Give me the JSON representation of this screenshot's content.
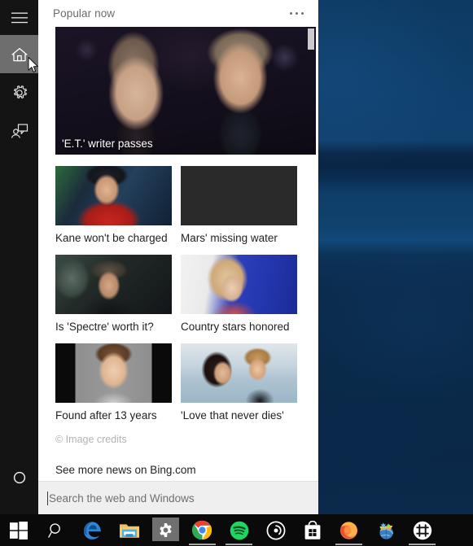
{
  "desktop": {
    "wallpaper_colors": [
      "#0d3a63",
      "#0a2747",
      "#11497a",
      "#0b2b4c"
    ]
  },
  "flyout": {
    "rail": {
      "items": [
        {
          "name": "hamburger",
          "icon": "hamburger-icon",
          "label": "Menu",
          "active": false
        },
        {
          "name": "home",
          "icon": "home-icon",
          "label": "Home",
          "active": true
        },
        {
          "name": "notebook",
          "icon": "gear-icon",
          "label": "Settings",
          "active": false
        },
        {
          "name": "feedback",
          "icon": "feedback-icon",
          "label": "Feedback",
          "active": false
        },
        {
          "name": "cortana",
          "icon": "cortana-circle-icon",
          "label": "Cortana",
          "active": false
        }
      ],
      "highlight_color": "#6e6e6e",
      "background_color": "#141414"
    },
    "header": {
      "title": "Popular now",
      "more_label": "More options",
      "more_icon": "ellipsis-icon"
    },
    "hero": {
      "caption": "'E.T.' writer passes",
      "thumb": "hero-photo"
    },
    "news": [
      {
        "label": "Kane won't be charged",
        "thumb": "th-hockey"
      },
      {
        "label": "Mars' missing water",
        "thumb": "th-mars"
      },
      {
        "label": "Is 'Spectre' worth it?",
        "thumb": "th-spectre"
      },
      {
        "label": "Country stars honored",
        "thumb": "th-country"
      },
      {
        "label": "Found after 13 years",
        "thumb": "th-boy"
      },
      {
        "label": "'Love that never dies'",
        "thumb": "th-love"
      }
    ],
    "credits": "© Image credits",
    "see_more": "See more news on Bing.com",
    "search": {
      "value": "",
      "placeholder": "Search the web and Windows"
    }
  },
  "taskbar": {
    "items": [
      {
        "name": "start-button",
        "icon": "windows-logo-icon",
        "label": "Start",
        "running": false,
        "active": false
      },
      {
        "name": "search-button",
        "icon": "search-icon",
        "label": "Search",
        "running": false,
        "active": false
      },
      {
        "name": "edge-button",
        "icon": "edge-icon",
        "label": "Microsoft Edge",
        "running": false,
        "active": false
      },
      {
        "name": "explorer-button",
        "icon": "folder-icon",
        "label": "File Explorer",
        "running": false,
        "active": false
      },
      {
        "name": "settings-button",
        "icon": "gear-icon",
        "label": "Settings",
        "running": true,
        "active": true
      },
      {
        "name": "chrome-button",
        "icon": "chrome-icon",
        "label": "Google Chrome",
        "running": true,
        "active": false
      },
      {
        "name": "spotify-button",
        "icon": "spotify-icon",
        "label": "Spotify",
        "running": true,
        "active": false
      },
      {
        "name": "groove-button",
        "icon": "groove-music-icon",
        "label": "Groove Music",
        "running": false,
        "active": false
      },
      {
        "name": "store-button",
        "icon": "store-bag-icon",
        "label": "Store",
        "running": false,
        "active": false
      },
      {
        "name": "firefox-button",
        "icon": "firefox-icon",
        "label": "Mozilla Firefox",
        "running": true,
        "active": false
      },
      {
        "name": "maps-button",
        "icon": "globe-star-icon",
        "label": "Maps",
        "running": false,
        "active": false
      },
      {
        "name": "snowflake-button",
        "icon": "snowflake-icon",
        "label": "App",
        "running": true,
        "active": false
      }
    ]
  }
}
